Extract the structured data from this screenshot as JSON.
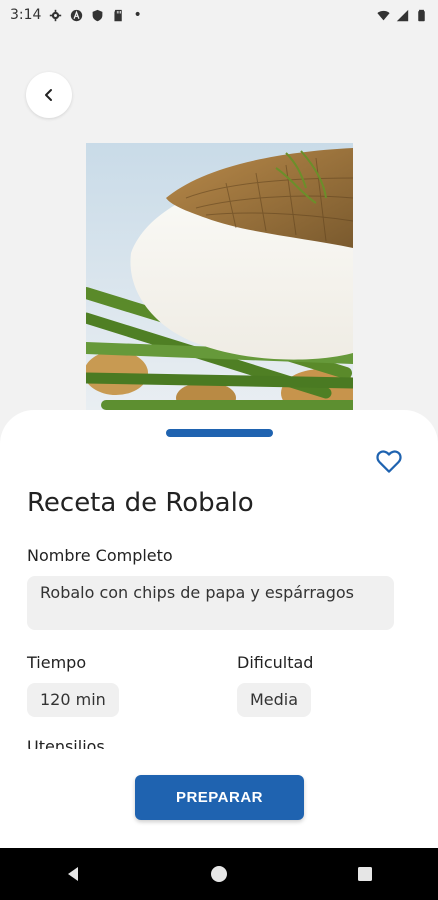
{
  "status_bar": {
    "time": "3:14",
    "dot": "•",
    "icons_left": [
      "gear-icon",
      "a-circle-icon",
      "shield-icon",
      "sd-card-icon"
    ],
    "icons_right": [
      "wifi-icon",
      "signal-icon",
      "battery-icon"
    ]
  },
  "header": {
    "back_icon": "chevron-left-icon"
  },
  "recipe": {
    "image_alt": "food-photo",
    "favorite_icon": "heart-outline-icon",
    "title": "Receta de Robalo",
    "full_name_label": "Nombre Completo",
    "full_name_value": "Robalo con chips de papa y espárragos",
    "time_label": "Tiempo",
    "time_value": "120 min",
    "difficulty_label": "Dificultad",
    "difficulty_value": "Media",
    "utensils_label": "Utensilios"
  },
  "action": {
    "prepare_label": "PREPARAR"
  },
  "colors": {
    "accent": "#1f63b0",
    "background": "#f2f2f2",
    "sheet": "#ffffff",
    "field_bg": "#f0f0f0"
  },
  "nav": {
    "back_icon": "triangle-back-icon",
    "home_icon": "circle-home-icon",
    "recents_icon": "square-recents-icon"
  }
}
